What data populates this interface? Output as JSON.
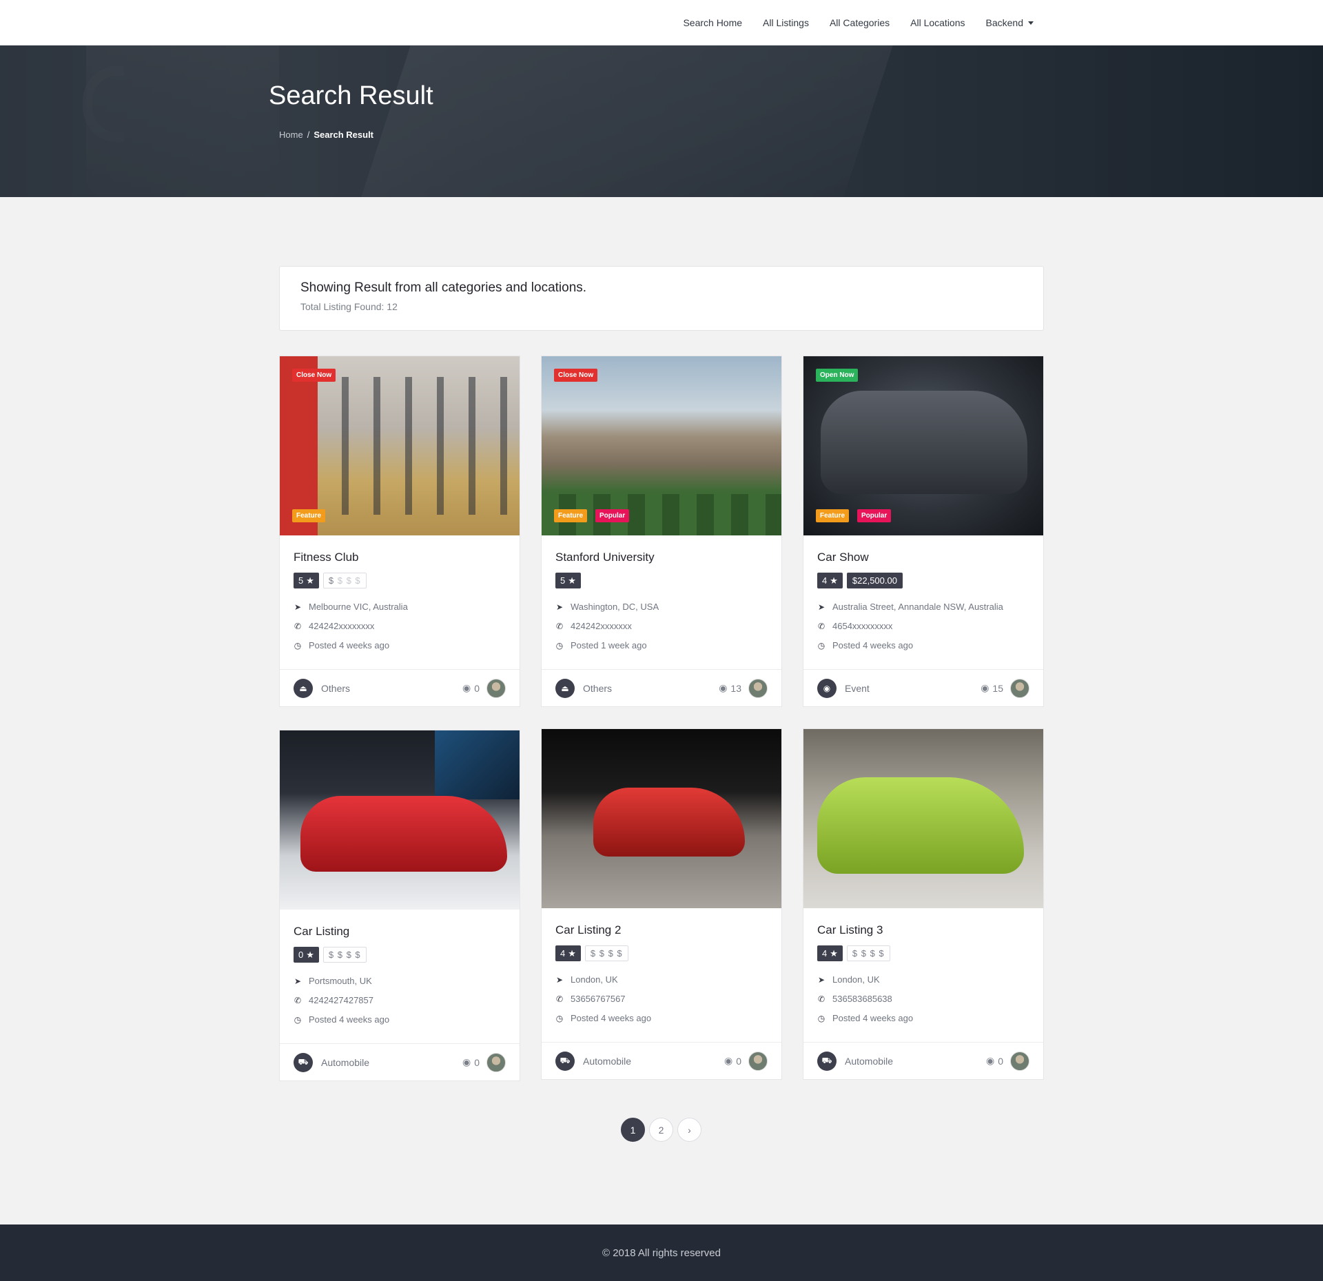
{
  "nav": {
    "items": [
      "Search Home",
      "All Listings",
      "All Categories",
      "All Locations",
      "Backend"
    ]
  },
  "hero": {
    "title": "Search Result",
    "breadcrumb": {
      "home": "Home",
      "separator": "/",
      "current": "Search Result"
    }
  },
  "result": {
    "title": "Showing Result from all categories and locations.",
    "subtitle": "Total Listing Found: 12"
  },
  "listings": [
    {
      "title": "Fitness Club",
      "status": "Close Now",
      "badges": [
        "Feature"
      ],
      "rating": "5",
      "price": "$ $ $ $",
      "location": "Melbourne VIC, Australia",
      "phone": "424242xxxxxxxx",
      "posted": "Posted 4 weeks ago",
      "category": "Others",
      "category_icon": "eject-icon",
      "views": "0"
    },
    {
      "title": "Stanford University",
      "status": "Close Now",
      "badges": [
        "Feature",
        "Popular"
      ],
      "rating": "5",
      "price": "",
      "location": "Washington, DC, USA",
      "phone": "424242xxxxxxx",
      "posted": "Posted 1 week ago",
      "category": "Others",
      "category_icon": "eject-icon",
      "views": "13"
    },
    {
      "title": "Car Show",
      "status": "Open Now",
      "badges": [
        "Feature",
        "Popular"
      ],
      "rating": "4",
      "price": "$22,500.00",
      "location": "Australia Street, Annandale NSW, Australia",
      "phone": "4654xxxxxxxxx",
      "posted": "Posted 4 weeks ago",
      "category": "Event",
      "category_icon": "eye-icon",
      "views": "15"
    },
    {
      "title": "Car Listing",
      "status": "",
      "badges": [],
      "rating": "0",
      "price": "$ $ $ $",
      "location": "Portsmouth, UK",
      "phone": "4242427427857",
      "posted": "Posted 4 weeks ago",
      "category": "Automobile",
      "category_icon": "car-icon",
      "views": "0"
    },
    {
      "title": "Car Listing 2",
      "status": "",
      "badges": [],
      "rating": "4",
      "price": "$ $ $ $",
      "location": "London, UK",
      "phone": "53656767567",
      "posted": "Posted 4 weeks ago",
      "category": "Automobile",
      "category_icon": "car-icon",
      "views": "0"
    },
    {
      "title": "Car Listing 3",
      "status": "",
      "badges": [],
      "rating": "4",
      "price": "$ $ $ $",
      "location": "London, UK",
      "phone": "536583685638",
      "posted": "Posted 4 weeks ago",
      "category": "Automobile",
      "category_icon": "car-icon",
      "views": "0"
    }
  ],
  "pagination": {
    "pages": [
      "1",
      "2"
    ],
    "next": "›",
    "active": "1"
  },
  "footer": {
    "text": "© 2018 All rights reserved"
  },
  "colors": {
    "accent_dark": "#3d3f4d",
    "close_now": "#e2302f",
    "open_now": "#2bb35b",
    "feature": "#f39c1b",
    "popular": "#e8145a",
    "footer_bg": "#242b36"
  }
}
